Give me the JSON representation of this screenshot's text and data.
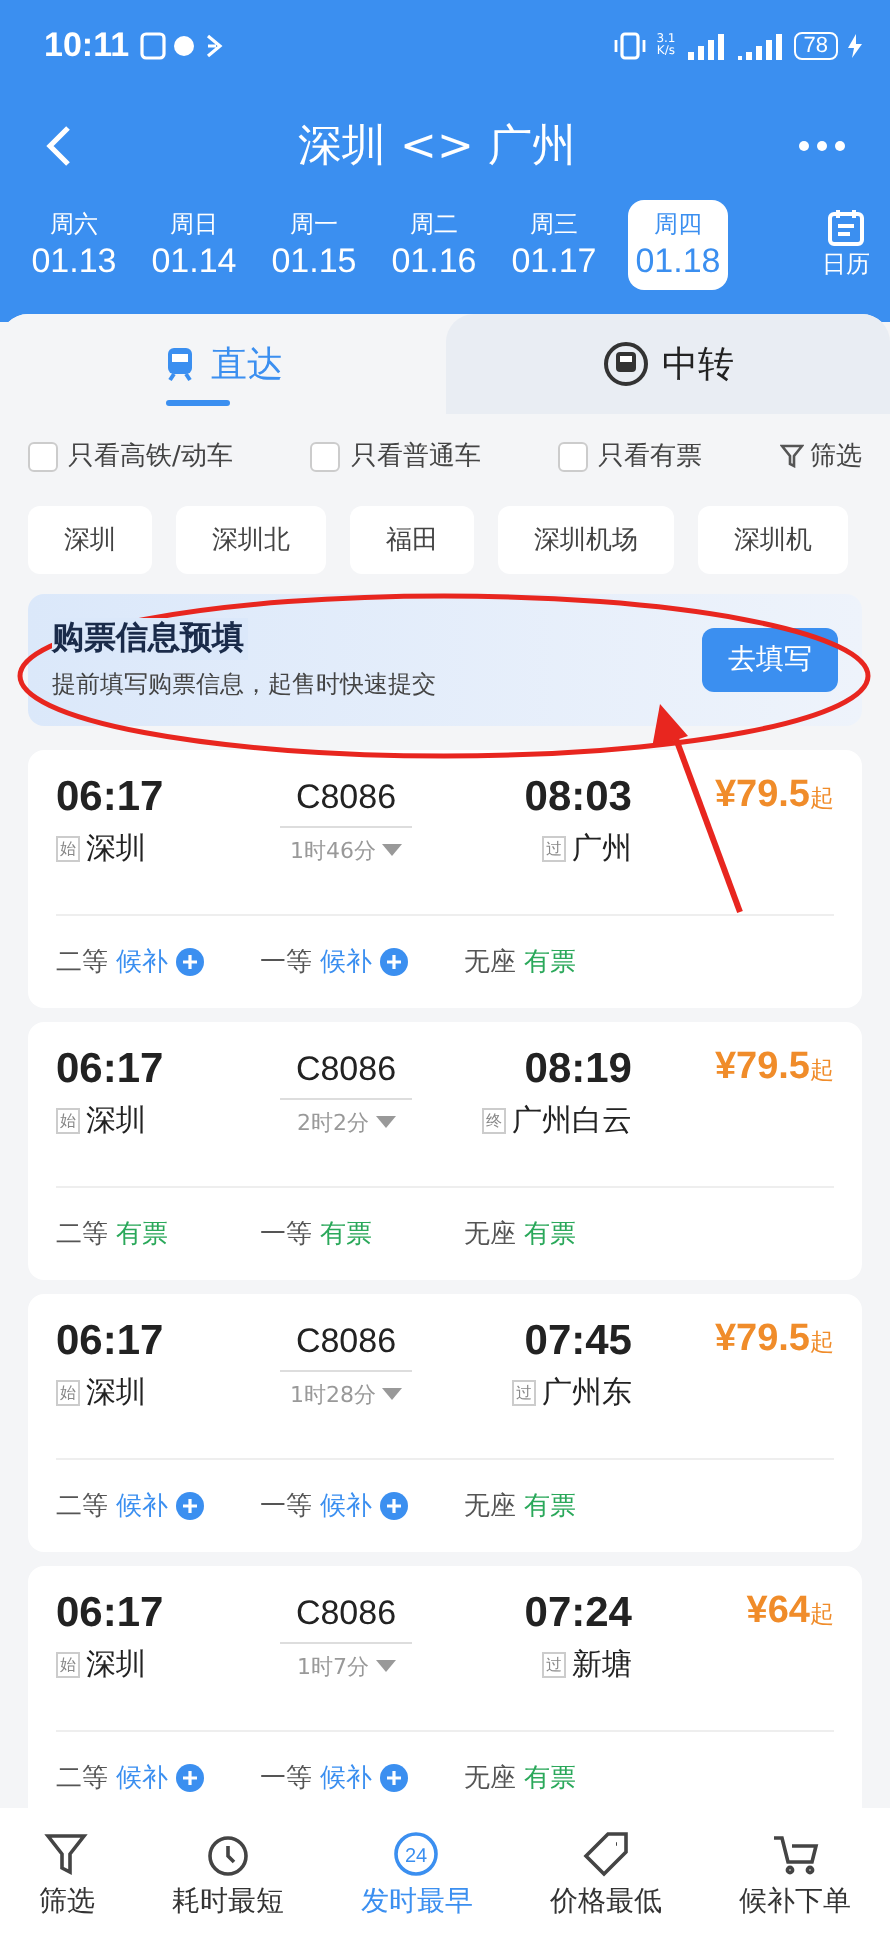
{
  "status_bar": {
    "time": "10:11",
    "speed": "3.1\nK/s",
    "battery": "78"
  },
  "header": {
    "title": "深圳 <> 广州"
  },
  "dates": [
    {
      "weekday": "周六",
      "date": "01.13",
      "selected": false
    },
    {
      "weekday": "周日",
      "date": "01.14",
      "selected": false
    },
    {
      "weekday": "周一",
      "date": "01.15",
      "selected": false
    },
    {
      "weekday": "周二",
      "date": "01.16",
      "selected": false
    },
    {
      "weekday": "周三",
      "date": "01.17",
      "selected": false
    },
    {
      "weekday": "周四",
      "date": "01.18",
      "selected": true
    }
  ],
  "calendar_label": "日历",
  "tabs": [
    {
      "label": "直达",
      "selected": true
    },
    {
      "label": "中转",
      "selected": false
    }
  ],
  "filters": [
    {
      "label": "只看高铁/动车",
      "checked": false
    },
    {
      "label": "只看普通车",
      "checked": false
    },
    {
      "label": "只看有票",
      "checked": false
    }
  ],
  "filter_button": "筛选",
  "stations": [
    "深圳",
    "深圳北",
    "福田",
    "深圳机场",
    "深圳机"
  ],
  "banner": {
    "title": "购票信息预填",
    "subtitle": "提前填写购票信息，起售时快速提交",
    "button": "去填写"
  },
  "trains": [
    {
      "depart": "06:17",
      "from_tag": "始",
      "from": "深圳",
      "number": "C8086",
      "duration": "1时46分",
      "arrive": "08:03",
      "to_tag": "过",
      "to": "广州",
      "price": "¥79.5",
      "price_suffix": "起",
      "seats": [
        {
          "class": "二等",
          "status": "候补",
          "kind": "waitlist"
        },
        {
          "class": "一等",
          "status": "候补",
          "kind": "waitlist"
        },
        {
          "class": "无座",
          "status": "有票",
          "kind": "available"
        }
      ]
    },
    {
      "depart": "06:17",
      "from_tag": "始",
      "from": "深圳",
      "number": "C8086",
      "duration": "2时2分",
      "arrive": "08:19",
      "to_tag": "终",
      "to": "广州白云",
      "price": "¥79.5",
      "price_suffix": "起",
      "seats": [
        {
          "class": "二等",
          "status": "有票",
          "kind": "available"
        },
        {
          "class": "一等",
          "status": "有票",
          "kind": "available"
        },
        {
          "class": "无座",
          "status": "有票",
          "kind": "available"
        }
      ]
    },
    {
      "depart": "06:17",
      "from_tag": "始",
      "from": "深圳",
      "number": "C8086",
      "duration": "1时28分",
      "arrive": "07:45",
      "to_tag": "过",
      "to": "广州东",
      "price": "¥79.5",
      "price_suffix": "起",
      "seats": [
        {
          "class": "二等",
          "status": "候补",
          "kind": "waitlist"
        },
        {
          "class": "一等",
          "status": "候补",
          "kind": "waitlist"
        },
        {
          "class": "无座",
          "status": "有票",
          "kind": "available"
        }
      ]
    },
    {
      "depart": "06:17",
      "from_tag": "始",
      "from": "深圳",
      "number": "C8086",
      "duration": "1时7分",
      "arrive": "07:24",
      "to_tag": "过",
      "to": "新塘",
      "price": "¥64",
      "price_suffix": "起",
      "seats": [
        {
          "class": "二等",
          "status": "候补",
          "kind": "waitlist"
        },
        {
          "class": "一等",
          "status": "候补",
          "kind": "waitlist"
        },
        {
          "class": "无座",
          "status": "有票",
          "kind": "available"
        }
      ]
    }
  ],
  "bottom_nav": [
    {
      "label": "筛选",
      "kind": "filter",
      "selected": false
    },
    {
      "label": "耗时最短",
      "kind": "clock",
      "selected": false
    },
    {
      "label": "发时最早",
      "kind": "badge",
      "badge": "24",
      "selected": true
    },
    {
      "label": "价格最低",
      "kind": "tag",
      "selected": false
    },
    {
      "label": "候补下单",
      "kind": "cart",
      "selected": false
    }
  ]
}
